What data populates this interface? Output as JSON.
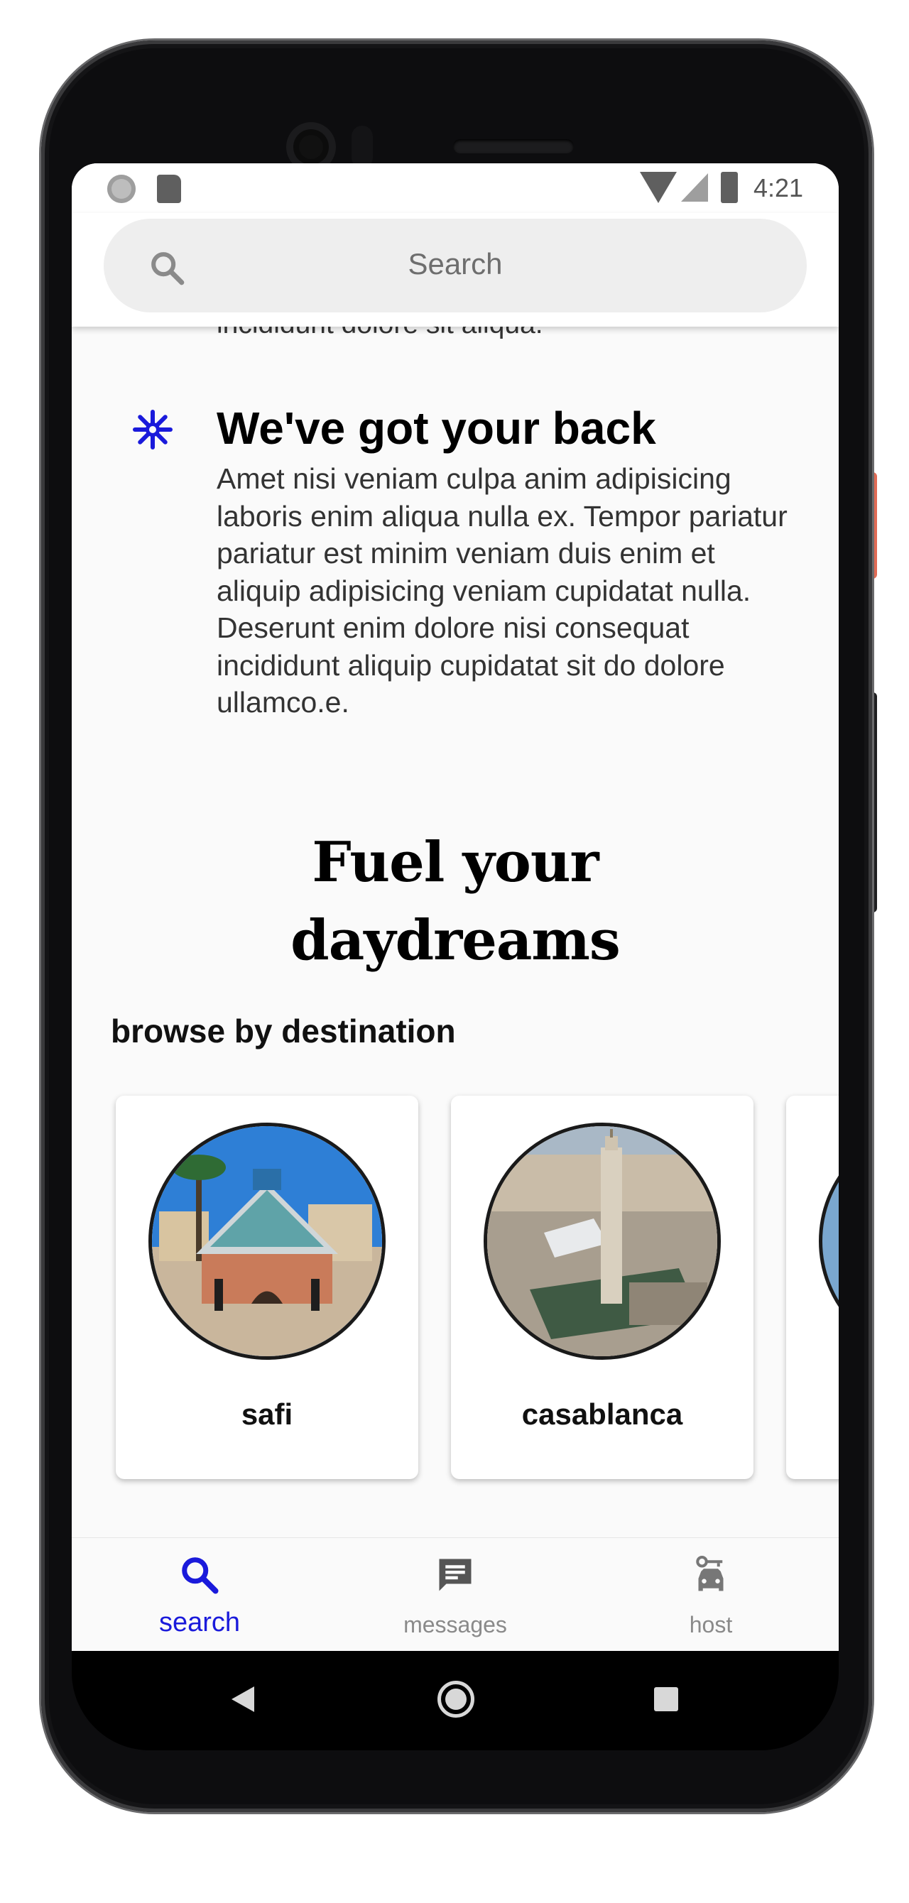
{
  "status_bar": {
    "time": "4:21"
  },
  "search": {
    "placeholder": "Search"
  },
  "content": {
    "partial_text": "incididunt dolore sit aliqua.",
    "feature": {
      "icon": "asterisk-icon",
      "title": "We've got your back",
      "body": "Amet nisi veniam culpa anim adipisicing laboris enim aliqua nulla ex. Tempor pariatur pariatur est minim veniam duis enim et aliquip adipisicing veniam cupidatat nulla. Deserunt enim dolore nisi consequat incididunt aliquip cupidatat sit do dolore ullamco.e."
    },
    "headline_line1": "Fuel your",
    "headline_line2": "daydreams",
    "browse_label": "browse by destination",
    "destinations": [
      {
        "name": "safi"
      },
      {
        "name": "casablanca"
      }
    ]
  },
  "bottom_nav": [
    {
      "label": "search",
      "icon": "search-icon",
      "active": true
    },
    {
      "label": "messages",
      "icon": "message-icon",
      "active": false
    },
    {
      "label": "host",
      "icon": "car-key-icon",
      "active": false
    }
  ],
  "colors": {
    "accent": "#1a1adb",
    "screen_bg": "#fafafa",
    "search_bg": "#eeeeee"
  }
}
